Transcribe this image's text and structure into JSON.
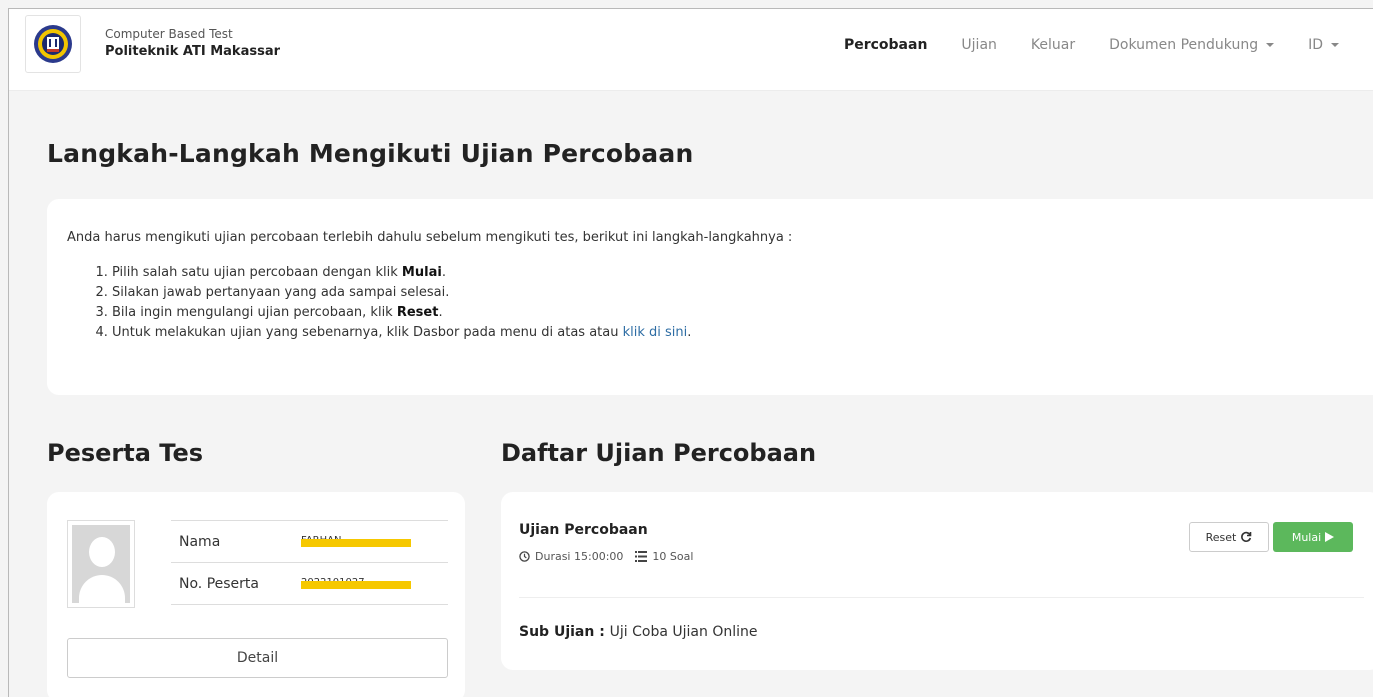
{
  "brand": {
    "subtitle": "Computer Based Test",
    "title": "Politeknik ATI Makassar"
  },
  "nav": {
    "items": [
      {
        "label": "Percobaan",
        "active": true
      },
      {
        "label": "Ujian"
      },
      {
        "label": "Keluar"
      },
      {
        "label": "Dokumen Pendukung",
        "dropdown": true
      },
      {
        "label": "ID",
        "dropdown": true
      }
    ]
  },
  "page_title": "Langkah-Langkah Mengikuti Ujian Percobaan",
  "instructions": {
    "intro": "Anda harus mengikuti ujian percobaan terlebih dahulu sebelum mengikuti tes, berikut ini langkah-langkahnya :",
    "steps": [
      {
        "prefix": "Pilih salah satu ujian percobaan dengan klik ",
        "bold": "Mulai",
        "suffix": "."
      },
      {
        "text": "Silakan jawab pertanyaan yang ada sampai selesai."
      },
      {
        "prefix": "Bila ingin mengulangi ujian percobaan, klik ",
        "bold": "Reset",
        "suffix": "."
      },
      {
        "prefix": "Untuk melakukan ujian yang sebenarnya, klik Dasbor pada menu di atas atau ",
        "link": "klik di sini",
        "suffix": "."
      }
    ]
  },
  "peserta": {
    "heading": "Peserta Tes",
    "rows": [
      {
        "label": "Nama",
        "value": "FARHAN"
      },
      {
        "label": "No. Peserta",
        "value": "2022101027"
      }
    ],
    "detail_label": "Detail"
  },
  "daftar": {
    "heading": "Daftar Ujian Percobaan",
    "exam": {
      "title": "Ujian Percobaan",
      "duration": "Durasi 15:00:00",
      "questions": "10 Soal",
      "reset_label": "Reset",
      "start_label": "Mulai",
      "sub_label": "Sub Ujian :",
      "sub_value": "Uji Coba Ujian Online"
    }
  },
  "colors": {
    "accent_green": "#5cb85c",
    "link_blue": "#2e6da4",
    "redaction": "#f6c800"
  }
}
